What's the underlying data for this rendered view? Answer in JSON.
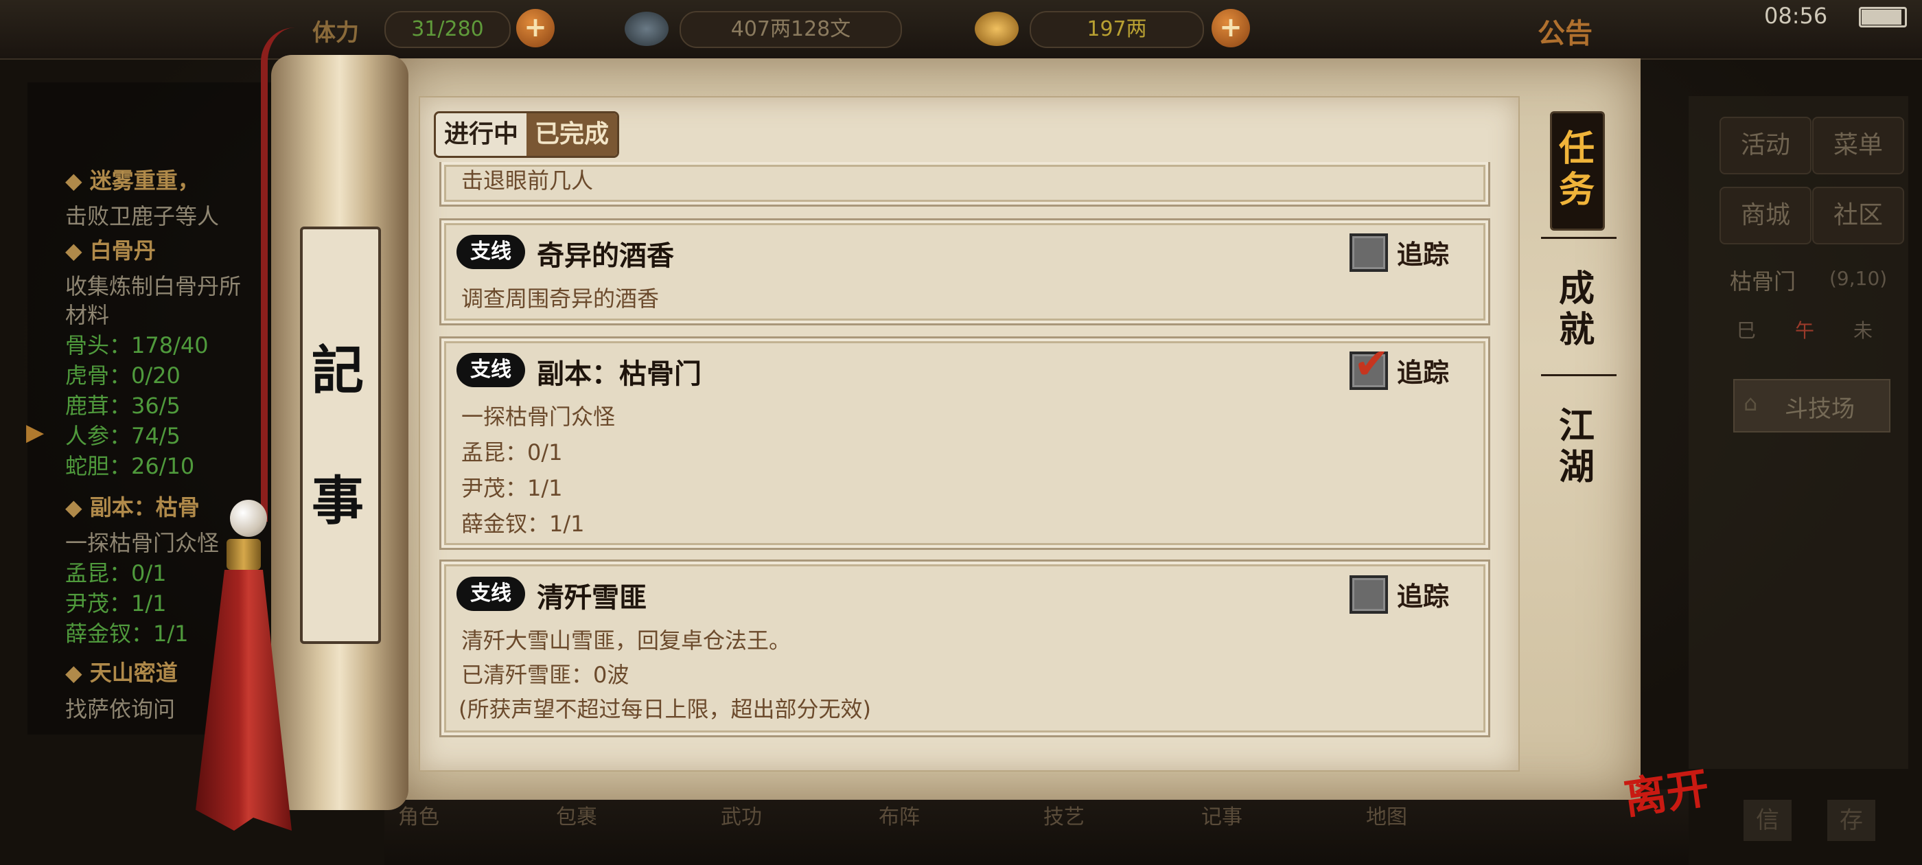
{
  "hud": {
    "bag_label": "体力",
    "bag_count": "31/280",
    "coins": "407两128文",
    "silver": "197两",
    "notice": "公告",
    "time": "08:56"
  },
  "left_panel": {
    "q1_title": "迷雾重重，",
    "q1_desc": "击败卫鹿子等人",
    "q2_title": "白骨丹",
    "q2_desc1": "收集炼制白骨丹所",
    "q2_desc2": "材料",
    "q2_items": [
      "骨头：178/40",
      "虎骨：0/20",
      "鹿茸：36/5",
      "人参：74/5",
      "蛇胆：26/10"
    ],
    "q3_title": "副本：枯骨",
    "q3_desc": "一探枯骨门众怪",
    "q3_items": [
      "孟昆：0/1",
      "尹茂：1/1",
      "薛金钗：1/1"
    ],
    "q4_title": "天山密道",
    "q4_desc": "找萨依询问"
  },
  "right_panel": {
    "buttons": [
      "活动",
      "菜单",
      "商城",
      "社区"
    ],
    "location": "枯骨门",
    "coords": "(9,10)",
    "time_marks": [
      "巳",
      "午",
      "未"
    ],
    "arena": "斗技场",
    "bottom_btns": [
      "信",
      "存"
    ]
  },
  "bottom_bar": [
    "角色",
    "包裹",
    "武功",
    "布阵",
    "技艺",
    "记事",
    "地图"
  ],
  "scroll": {
    "label_chars": [
      "記",
      "事"
    ]
  },
  "tabs": {
    "active": "进行中",
    "inactive": "已完成"
  },
  "quests": {
    "partial_desc": "击退眼前几人",
    "q1": {
      "badge": "支线",
      "title": "奇异的酒香",
      "lines": [
        "调查周围奇异的酒香"
      ],
      "tracked": false
    },
    "q2": {
      "badge": "支线",
      "title": "副本：枯骨门",
      "lines": [
        "一探枯骨门众怪",
        "孟昆：0/1",
        "尹茂：1/1",
        "薛金钗：1/1"
      ],
      "tracked": true
    },
    "q3": {
      "badge": "支线",
      "title": "清歼雪匪",
      "lines": [
        "清歼大雪山雪匪，回复卓仓法王。",
        "已清歼雪匪：0波",
        "(所获声望不超过每日上限，超出部分无效)"
      ],
      "tracked": false
    },
    "track_label": "追踪"
  },
  "side_tabs": {
    "active": [
      "任",
      "务"
    ],
    "achieve": [
      "成",
      "就"
    ],
    "jianghu": [
      "江",
      "湖"
    ]
  },
  "leave_label": "离开",
  "colors": {
    "accent": "#f0b43a",
    "check": "#c6351f",
    "leave": "#c91a12"
  }
}
